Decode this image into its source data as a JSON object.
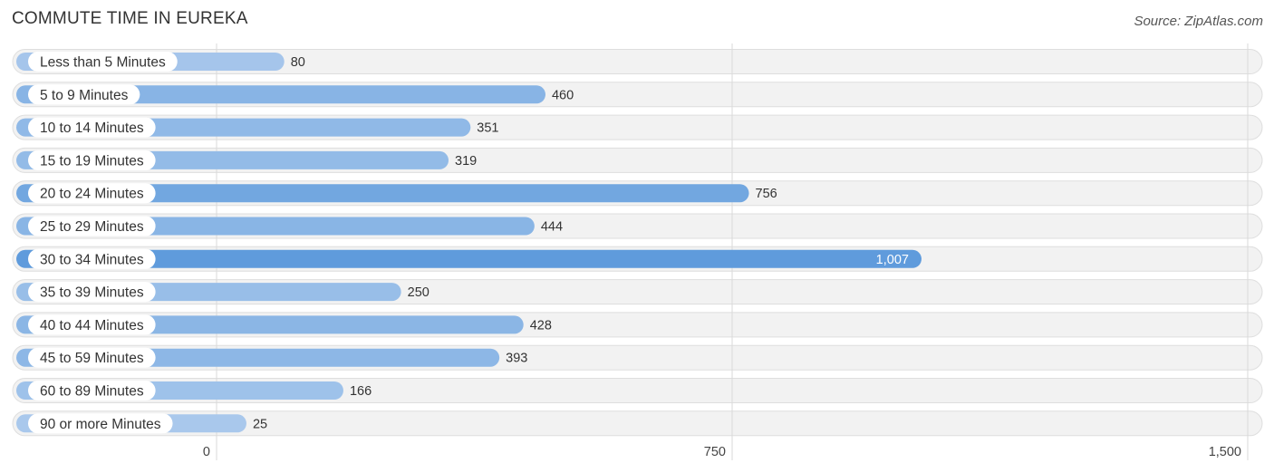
{
  "header": {
    "title": "COMMUTE TIME IN EUREKA",
    "source": "Source: ZipAtlas.com"
  },
  "chart_data": {
    "type": "bar",
    "orientation": "horizontal",
    "title": "COMMUTE TIME IN EUREKA",
    "xlabel": "",
    "ylabel": "",
    "categories": [
      "Less than 5 Minutes",
      "5 to 9 Minutes",
      "10 to 14 Minutes",
      "15 to 19 Minutes",
      "20 to 24 Minutes",
      "25 to 29 Minutes",
      "30 to 34 Minutes",
      "35 to 39 Minutes",
      "40 to 44 Minutes",
      "45 to 59 Minutes",
      "60 to 89 Minutes",
      "90 or more Minutes"
    ],
    "values": [
      80,
      460,
      351,
      319,
      756,
      444,
      1007,
      250,
      428,
      393,
      166,
      25
    ],
    "value_labels": [
      "80",
      "460",
      "351",
      "319",
      "756",
      "444",
      "1,007",
      "250",
      "428",
      "393",
      "166",
      "25"
    ],
    "xlim": [
      0,
      1500
    ],
    "xticks": [
      0,
      750,
      1500
    ],
    "xtick_labels": [
      "0",
      "750",
      "1,500"
    ],
    "grid": true,
    "legend": "none",
    "highlight_index": 6,
    "colors": {
      "bar_max": "#5f9bdc",
      "bar_min": "#a9c8ec",
      "track": "#f2f2f2",
      "track_border": "#dedede",
      "grid": "#d9d9d9"
    }
  }
}
